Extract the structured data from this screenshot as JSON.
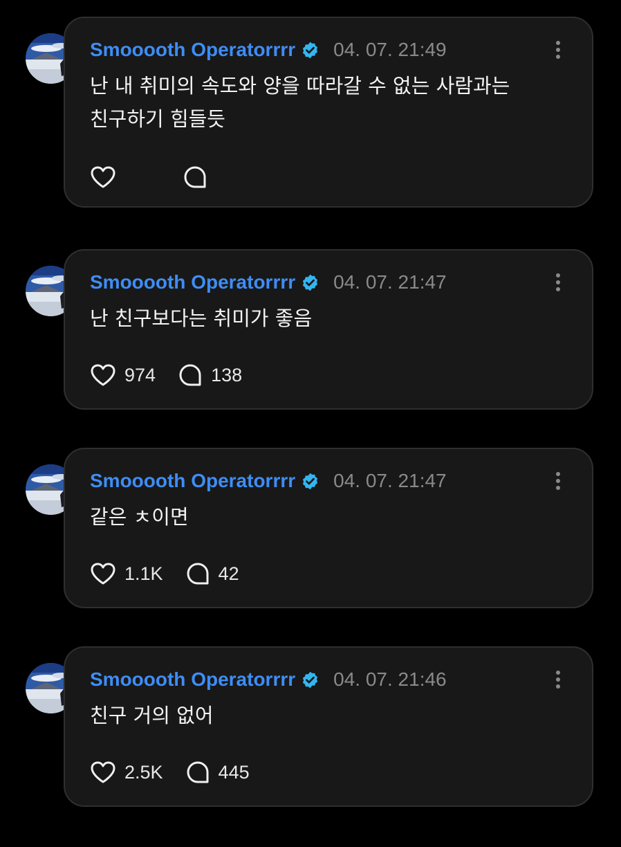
{
  "colors": {
    "background": "#000000",
    "card": "#181818",
    "username": "#3e8df5",
    "verified_badge": "#33b6f0",
    "timestamp": "#8a8a8a"
  },
  "icons": {
    "like": "heart-outline-icon",
    "reply": "speech-bubble-icon",
    "more": "vertical-ellipsis-icon",
    "verified": "verified-badge-icon"
  },
  "posts": [
    {
      "username": "Smooooth Operatorrrr",
      "timestamp": "04. 07. 21:49",
      "text_lines": [
        "난 내 취미의 속도와 양을 따라갈 수 없는 사람과는",
        "친구하기 힘들듯"
      ],
      "likes": "",
      "replies": ""
    },
    {
      "username": "Smooooth Operatorrrr",
      "timestamp": "04. 07. 21:47",
      "text_lines": [
        "난 친구보다는 취미가 좋음"
      ],
      "likes": "974",
      "replies": "138"
    },
    {
      "username": "Smooooth Operatorrrr",
      "timestamp": "04. 07. 21:47",
      "text_lines": [
        "같은 ㅊ이면"
      ],
      "likes": "1.1K",
      "replies": "42"
    },
    {
      "username": "Smooooth Operatorrrr",
      "timestamp": "04. 07. 21:46",
      "text_lines": [
        "친구 거의 없어"
      ],
      "likes": "2.5K",
      "replies": "445"
    }
  ]
}
